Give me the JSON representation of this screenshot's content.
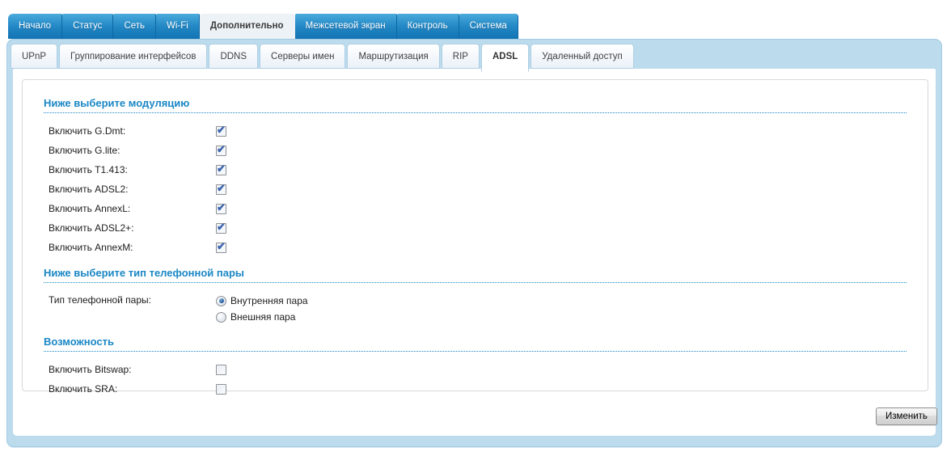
{
  "top_nav": {
    "tabs": [
      {
        "label": "Начало",
        "active": false
      },
      {
        "label": "Статус",
        "active": false
      },
      {
        "label": "Сеть",
        "active": false
      },
      {
        "label": "Wi-Fi",
        "active": false
      },
      {
        "label": "Дополнительно",
        "active": true
      },
      {
        "label": "Межсетевой экран",
        "active": false
      },
      {
        "label": "Контроль",
        "active": false
      },
      {
        "label": "Система",
        "active": false
      }
    ]
  },
  "sub_nav": {
    "tabs": [
      {
        "label": "UPnP",
        "active": false
      },
      {
        "label": "Группирование интерфейсов",
        "active": false
      },
      {
        "label": "DDNS",
        "active": false
      },
      {
        "label": "Серверы имен",
        "active": false
      },
      {
        "label": "Маршрутизация",
        "active": false
      },
      {
        "label": "RIP",
        "active": false
      },
      {
        "label": "ADSL",
        "active": true
      },
      {
        "label": "Удаленный доступ",
        "active": false
      }
    ]
  },
  "form": {
    "modulation": {
      "title": "Ниже выберите модуляцию",
      "checkboxes": [
        {
          "label": "Включить G.Dmt:",
          "checked": true
        },
        {
          "label": "Включить G.lite:",
          "checked": true
        },
        {
          "label": "Включить T1.413:",
          "checked": true
        },
        {
          "label": "Включить ADSL2:",
          "checked": true
        },
        {
          "label": "Включить AnnexL:",
          "checked": true
        },
        {
          "label": "Включить ADSL2+:",
          "checked": true
        },
        {
          "label": "Включить AnnexM:",
          "checked": true
        }
      ]
    },
    "phone_pair": {
      "title": "Ниже выберите тип телефонной пары",
      "label": "Тип телефонной пары:",
      "options": [
        {
          "label": "Внутренняя пара",
          "selected": true
        },
        {
          "label": "Внешняя пара",
          "selected": false
        }
      ]
    },
    "capability": {
      "title": "Возможность",
      "checkboxes": [
        {
          "label": "Включить Bitswap:",
          "checked": false
        },
        {
          "label": "Включить SRA:",
          "checked": false
        }
      ]
    },
    "submit_label": "Изменить"
  },
  "icons": {
    "check": "✔"
  },
  "colors": {
    "accent": "#1a87c5",
    "tab_blue_top": "#4aabdb",
    "tab_blue_bottom": "#1273b2",
    "frame_blue": "#bcdbed",
    "check_blue": "#3a62ad"
  }
}
